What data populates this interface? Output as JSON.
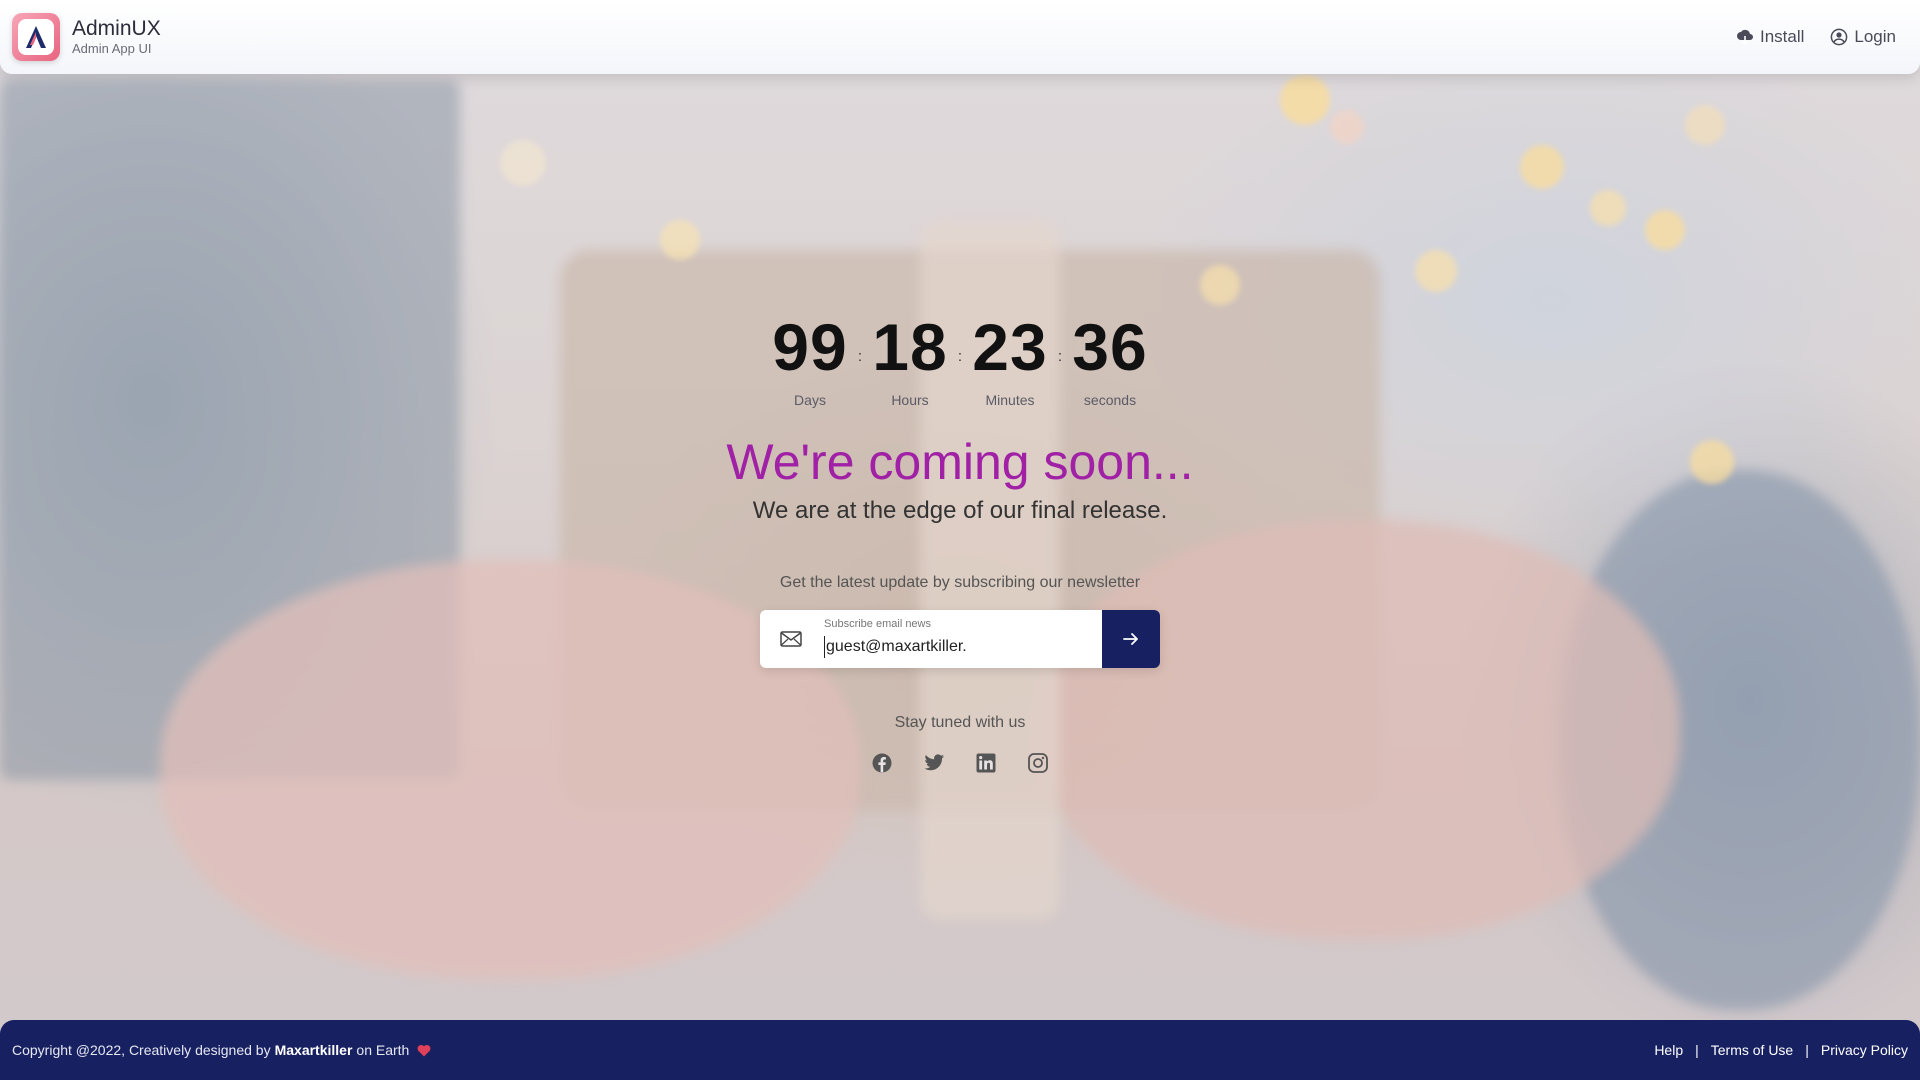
{
  "header": {
    "brand_name": "AdminUX",
    "brand_sub": "Admin App UI",
    "logo_letter": "A",
    "install_label": "Install",
    "login_label": "Login"
  },
  "countdown": {
    "days": "99",
    "days_label": "Days",
    "hours": "18",
    "hours_label": "Hours",
    "minutes": "23",
    "minutes_label": "Minutes",
    "seconds": "36",
    "seconds_label": "seconds",
    "separator": ":"
  },
  "hero": {
    "title": "We're coming soon...",
    "subtitle": "We are at the edge of our final release."
  },
  "newsletter": {
    "prompt": "Get the latest update by subscribing our newsletter",
    "field_label": "Subscribe email news",
    "field_value": "guest@maxartkiller."
  },
  "social": {
    "heading": "Stay tuned with us",
    "icons": [
      "facebook-icon",
      "twitter-icon",
      "linkedin-icon",
      "instagram-icon"
    ]
  },
  "footer": {
    "copyright_prefix": "Copyright @2022, Creatively designed by",
    "designer": "Maxartkiller",
    "copyright_suffix": "on Earth",
    "links": [
      "Help",
      "Terms of Use",
      "Privacy Policy"
    ],
    "link_separator": "|"
  },
  "colors": {
    "brand_dark": "#172061",
    "title_purple": "#a020a6",
    "heart_red": "#e0405a"
  }
}
